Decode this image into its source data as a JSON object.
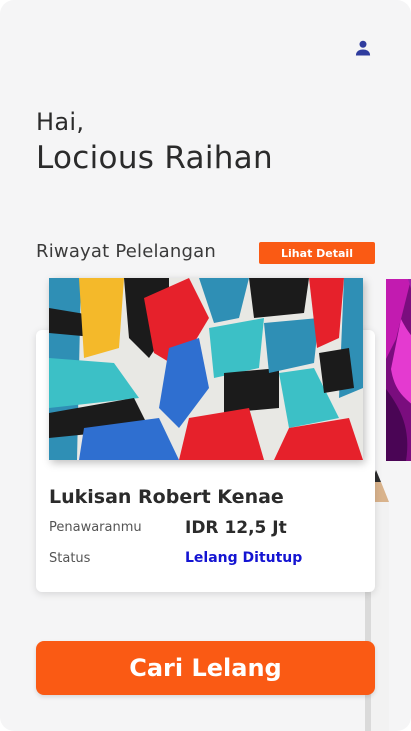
{
  "header": {
    "profile_icon": "user-icon"
  },
  "greeting": {
    "hello": "Hai,",
    "name": "Locious Raihan"
  },
  "history": {
    "title": "Riwayat Pelelangan",
    "detail_button": "Lihat Detail",
    "item": {
      "name": "Lukisan Robert Kenae",
      "bid_label": "Penawaranmu",
      "bid_value": "IDR 12,5 Jt",
      "status_label": "Status",
      "status_value": "Lelang Ditutup"
    }
  },
  "cta": {
    "label": "Cari Lelang"
  },
  "colors": {
    "accent": "#FA5A14",
    "status": "#1414D2",
    "icon": "#2F3C9E"
  }
}
